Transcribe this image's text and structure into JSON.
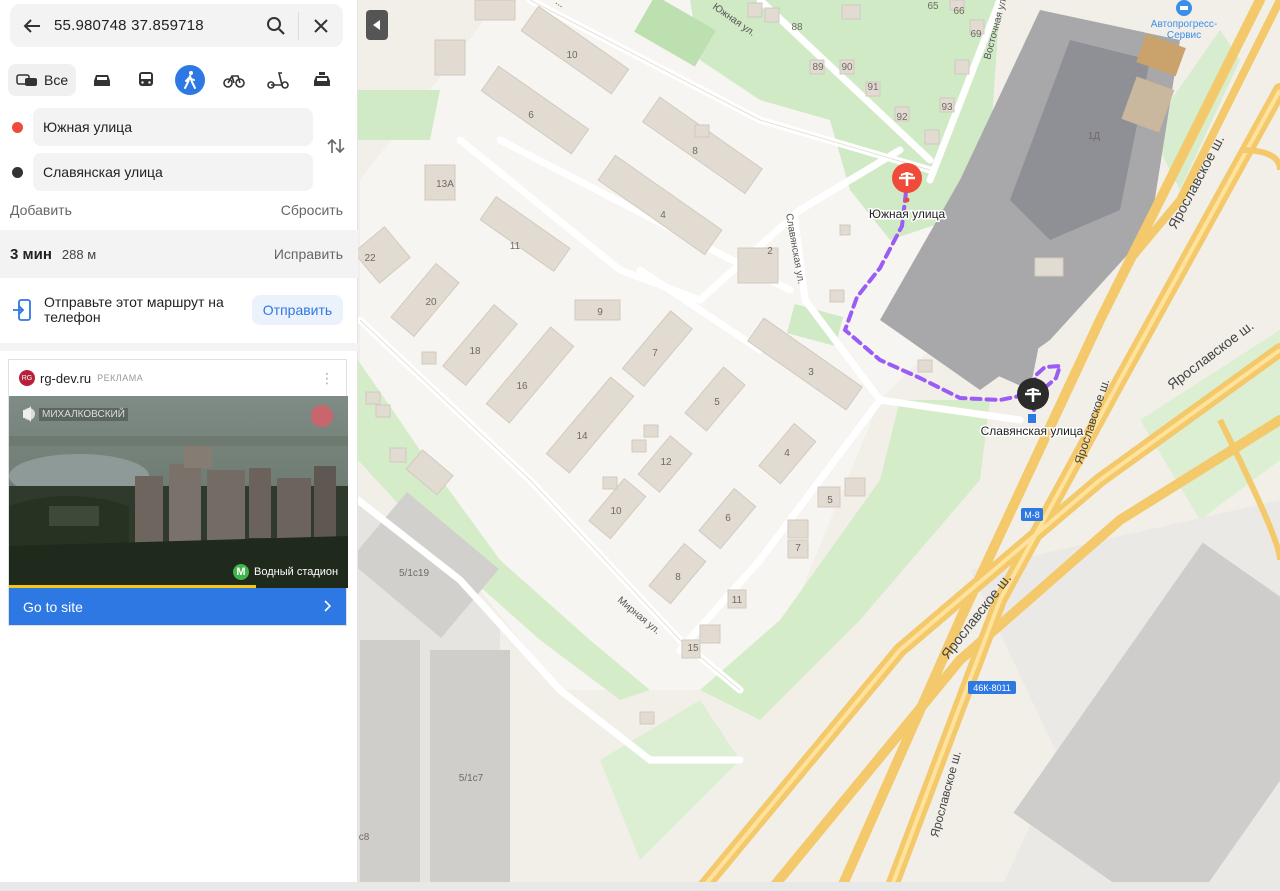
{
  "search": {
    "query": "55.980748 37.859718"
  },
  "modes": {
    "all_label": "Все",
    "items": [
      "car-icon",
      "bus-icon",
      "walk-icon",
      "bike-icon",
      "scooter-icon",
      "taxi-icon"
    ],
    "active": "walk-icon"
  },
  "route": {
    "from": "Южная улица",
    "to": "Славянская улица",
    "add": "Добавить",
    "reset": "Сбросить",
    "time": "3 мин",
    "distance": "288 м",
    "fix": "Исправить"
  },
  "send": {
    "text": "Отправьте этот маршрут на телефон",
    "button": "Отправить"
  },
  "ad": {
    "logo": "RG",
    "domain": "rg-dev.ru",
    "label": "РЕКЛАМА",
    "brand": "МИХАЛКОВСКИЙ",
    "metro": "Водный стадион",
    "metro_letter": "M",
    "cta": "Go to site",
    "progress": 0.73
  },
  "map": {
    "start_label": "Южная улица",
    "end_label": "Славянская улица",
    "streets": {
      "yuzhnaya": "Южная ул.",
      "slavyanskaya": "Славянская ул.",
      "vostochnaya": "Восточная ул.",
      "mirnaya": "Мирная ул.",
      "yaroslavskoe1": "Ярославское ш.",
      "yaroslavskoe2": "Ярославское ш.",
      "yaroslavskoe3": "Ярославское ш.",
      "yaroslavskoe4": "Ярославское ш."
    },
    "road_badges": {
      "m8": "М-8",
      "r46k": "46К-8011"
    },
    "poi": {
      "name_line1": "Автопрогресс-",
      "name_line2": "Сервис"
    },
    "house_numbers": {
      "h10a": "10",
      "h6": "6",
      "h8a": "8",
      "h4a": "4",
      "h13a": "13А",
      "h11": "11",
      "h2": "2",
      "h22": "22",
      "h20": "20",
      "h9": "9",
      "h7": "7",
      "h3": "3",
      "h18": "18",
      "h16": "16",
      "h5a": "5",
      "h14": "14",
      "h12": "12",
      "h4b": "4",
      "h10b": "10",
      "h6b": "6",
      "h5b": "5",
      "h7b": "7",
      "h8b": "8",
      "h11b": "11",
      "h15": "15",
      "h88": "88",
      "h89": "89",
      "h90": "90",
      "h91": "91",
      "h92": "92",
      "h93": "93",
      "h65": "65",
      "h66": "66",
      "h69": "69",
      "h1d": "1Д",
      "s5c19": "5/1с19",
      "s5c7": "5/1с7",
      "s8": "с8"
    }
  }
}
